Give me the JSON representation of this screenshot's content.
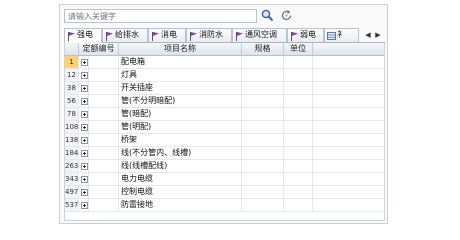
{
  "search": {
    "placeholder": "请输入关键字"
  },
  "tabs": [
    {
      "label": "强电",
      "active": true
    },
    {
      "label": "给排水"
    },
    {
      "label": "消电"
    },
    {
      "label": "消防水"
    },
    {
      "label": "通风空调"
    },
    {
      "label": "弱电"
    },
    {
      "label": "衤"
    }
  ],
  "table": {
    "columns": [
      "定额编号",
      "项目名称",
      "规格",
      "单位"
    ],
    "rows": [
      {
        "no": "1",
        "name": "配电箱",
        "selected": true
      },
      {
        "no": "12",
        "name": "灯具"
      },
      {
        "no": "38",
        "name": "开关插座"
      },
      {
        "no": "56",
        "name": "管(不分明暗配)"
      },
      {
        "no": "78",
        "name": "管(暗配)"
      },
      {
        "no": "108",
        "name": "管(明配)"
      },
      {
        "no": "138",
        "name": "桥架"
      },
      {
        "no": "184",
        "name": "线(不分管内、线槽)"
      },
      {
        "no": "263",
        "name": "线(线槽配线)"
      },
      {
        "no": "343",
        "name": "电力电缆"
      },
      {
        "no": "497",
        "name": "控制电缆"
      },
      {
        "no": "537",
        "name": "防雷接地"
      }
    ]
  },
  "colors": {
    "selected_row_marker": "#ffd36b",
    "tab_icon": "#8a3fa8",
    "search_icon": "#3a5fa8"
  }
}
